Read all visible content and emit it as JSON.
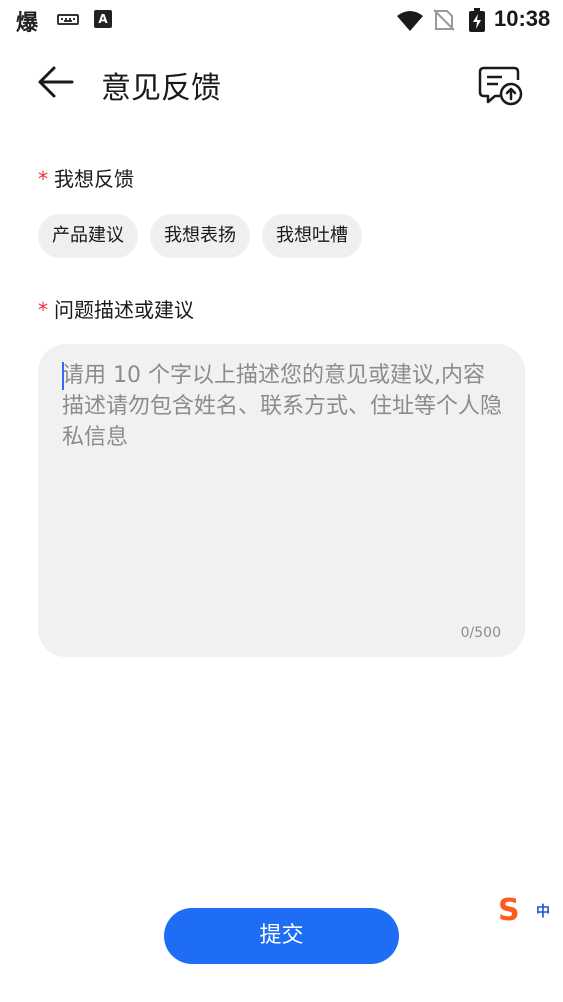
{
  "status_bar": {
    "app_icon_char": "爆",
    "keyboard_icon": "keyboard-icon",
    "accessibility_char": "A",
    "time": "10:38"
  },
  "app_bar": {
    "title": "意见反馈",
    "back_icon": "arrow-left-icon",
    "history_icon": "feedback-history-icon"
  },
  "form": {
    "required_mark": "*",
    "feedback_label": "我想反馈",
    "chips": [
      "产品建议",
      "我想表扬",
      "我想吐槽"
    ],
    "description_label": "问题描述或建议",
    "description": {
      "value": "",
      "placeholder": "请用 10 个字以上描述您的意见或建议,内容描述请勿包含姓名、联系方式、住址等个人隐私信息",
      "char_count": "0/500"
    }
  },
  "ime": {
    "logo_char": "S",
    "mode": "中"
  },
  "submit_label": "提交",
  "colors": {
    "accent": "#1f6df5",
    "required": "#e8333a",
    "chip_bg": "#efefef",
    "input_bg": "#f1f1f1"
  }
}
